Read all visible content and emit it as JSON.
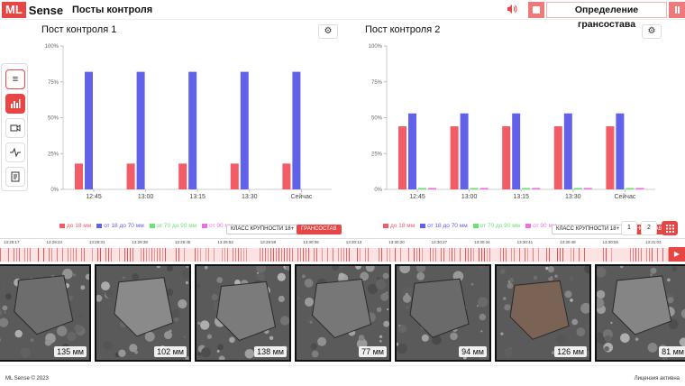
{
  "header": {
    "logo_ml": "ML",
    "logo_sense": "Sense",
    "title": "Посты контроля",
    "mode_title": "Определение грансостава"
  },
  "sidebar": {
    "icons": [
      "menu-icon",
      "bar-chart-icon",
      "video-icon",
      "activity-icon",
      "document-icon"
    ]
  },
  "panels": [
    {
      "title": "Пост контроля 1",
      "chips": [
        "КЛАСС КРУПНОСТИ 18+",
        "ГРАНСОСТАВ"
      ]
    },
    {
      "title": "Пост контроля 2",
      "chips": [
        "КЛАСС КРУПНОСТИ 18+",
        "ГРАНСОСТАВ"
      ]
    }
  ],
  "chart_data": [
    {
      "type": "bar",
      "categories": [
        "12:45",
        "13:00",
        "13:15",
        "13:30",
        "Сейчас"
      ],
      "ylim": [
        0,
        100
      ],
      "yticks": [
        "0%",
        "25%",
        "50%",
        "75%",
        "100%"
      ],
      "series": [
        {
          "name": "до 18 мм",
          "color": "#f25c67",
          "values": [
            18,
            18,
            18,
            18,
            18
          ]
        },
        {
          "name": "от 18 до 70 мм",
          "color": "#6161ea",
          "values": [
            82,
            82,
            82,
            82,
            82
          ]
        },
        {
          "name": "от 70 до 90 мм",
          "color": "#6ee07a",
          "values": [
            0,
            0,
            0,
            0,
            0
          ]
        },
        {
          "name": "от 90 мм",
          "color": "#ee6fe0",
          "values": [
            0,
            0,
            0,
            0,
            0
          ]
        }
      ]
    },
    {
      "type": "bar",
      "categories": [
        "12:45",
        "13:00",
        "13:15",
        "13:30",
        "Сейчас"
      ],
      "ylim": [
        0,
        100
      ],
      "yticks": [
        "0%",
        "25%",
        "50%",
        "75%",
        "100%"
      ],
      "series": [
        {
          "name": "до 18 мм",
          "color": "#f25c67",
          "values": [
            44,
            44,
            44,
            44,
            44
          ]
        },
        {
          "name": "от 18 до 70 мм",
          "color": "#6161ea",
          "values": [
            53,
            53,
            53,
            53,
            53
          ]
        },
        {
          "name": "от 70 до 90 мм",
          "color": "#6ee07a",
          "values": [
            1,
            1,
            1,
            1,
            1
          ]
        },
        {
          "name": "от 90 мм",
          "color": "#ee6fe0",
          "values": [
            1,
            1,
            1,
            1,
            1
          ]
        }
      ]
    }
  ],
  "pagination": [
    "1",
    "2"
  ],
  "timeline": {
    "labels": [
      "13:29:17",
      "13:29:24",
      "13:29:31",
      "13:29:38",
      "13:29:45",
      "13:29:52",
      "13:29:59",
      "13:30:06",
      "13:30:13",
      "13:30:20",
      "13:30:27",
      "13:30:34",
      "13:30:41",
      "13:30:48",
      "13:30:55",
      "13:31:03"
    ]
  },
  "thumbnails": [
    {
      "size": "135 мм",
      "tone": "#6d6d6d"
    },
    {
      "size": "102 мм",
      "tone": "#8a8a8a"
    },
    {
      "size": "138 мм",
      "tone": "#7b7b7b"
    },
    {
      "size": "77 мм",
      "tone": "#777777"
    },
    {
      "size": "94 мм",
      "tone": "#6a6a6a"
    },
    {
      "size": "126 мм",
      "tone": "#7a6355"
    },
    {
      "size": "81 мм",
      "tone": "#858585"
    }
  ],
  "footer": {
    "copyright": "ML Sense © 2023",
    "license": "Лицензия активна"
  }
}
